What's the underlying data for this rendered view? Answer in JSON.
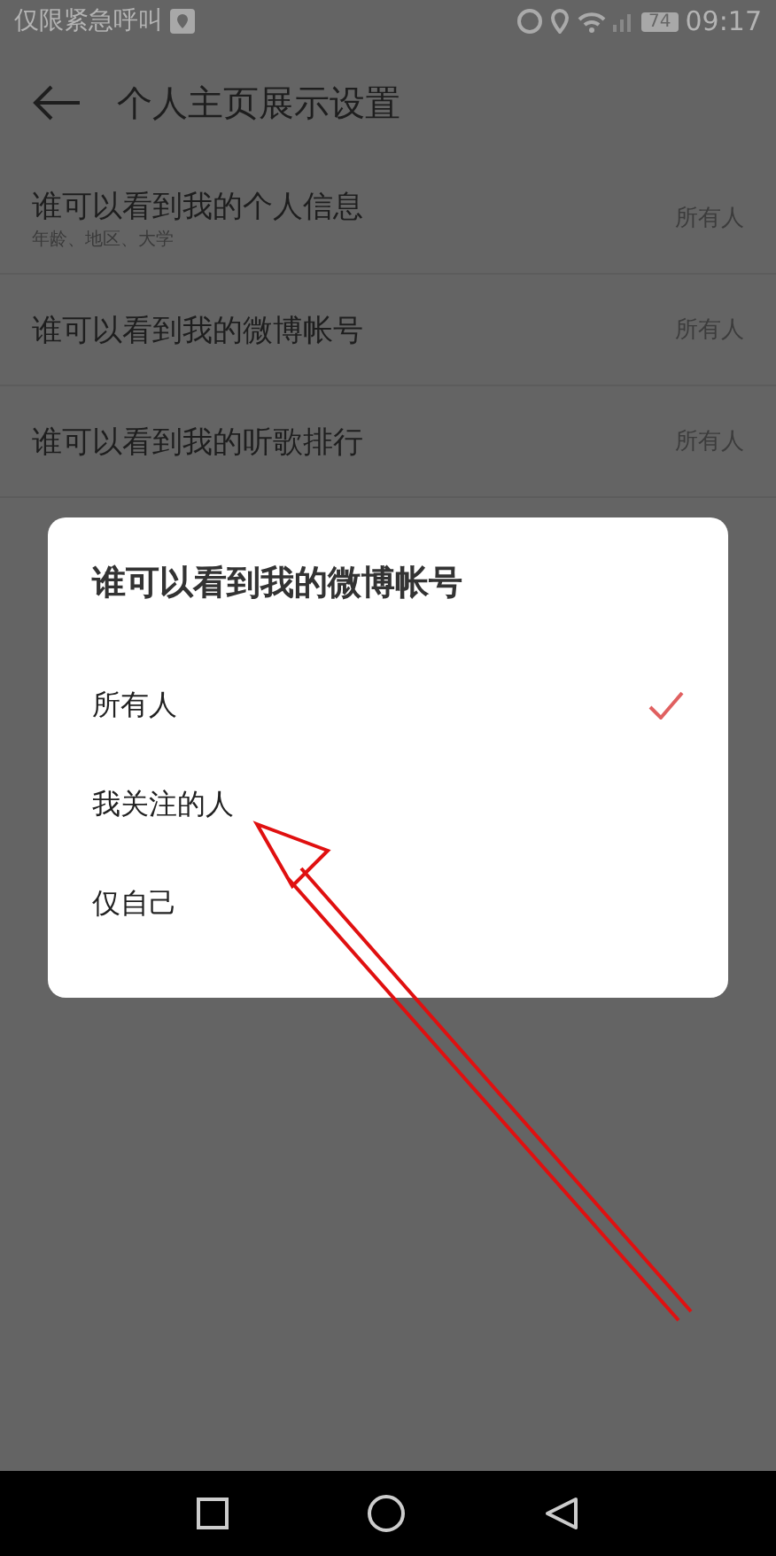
{
  "status_bar": {
    "notice": "仅限紧急呼叫",
    "battery": "74",
    "time": "09:17"
  },
  "header": {
    "title": "个人主页展示设置"
  },
  "rows": [
    {
      "label": "谁可以看到我的个人信息",
      "sub": "年龄、地区、大学",
      "value": "所有人"
    },
    {
      "label": "谁可以看到我的微博帐号",
      "value": "所有人"
    },
    {
      "label": "谁可以看到我的听歌排行",
      "value": "所有人"
    }
  ],
  "dialog": {
    "title": "谁可以看到我的微博帐号",
    "options": [
      {
        "label": "所有人",
        "selected": true
      },
      {
        "label": "我关注的人",
        "selected": false
      },
      {
        "label": "仅自己",
        "selected": false
      }
    ]
  }
}
